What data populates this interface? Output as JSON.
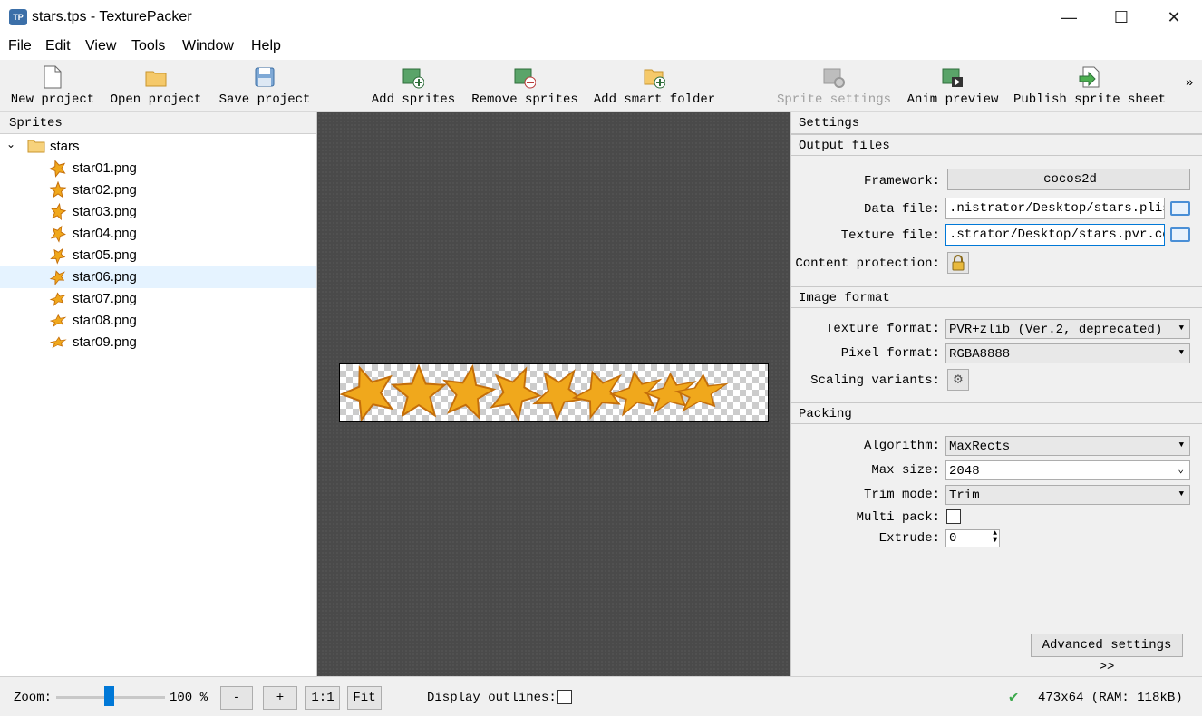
{
  "window": {
    "title": "stars.tps - TexturePacker",
    "app_icon_text": "TP",
    "minimize": "—",
    "maximize": "☐",
    "close": "✕"
  },
  "menu": [
    "File",
    "Edit",
    "View",
    "Tools",
    "Window",
    "Help"
  ],
  "toolbar": {
    "new_project": "New project",
    "open_project": "Open project",
    "save_project": "Save project",
    "add_sprites": "Add sprites",
    "remove_sprites": "Remove sprites",
    "add_smart_folder": "Add smart folder",
    "sprite_settings": "Sprite settings",
    "anim_preview": "Anim preview",
    "publish_sprite_sheet": "Publish sprite sheet",
    "overflow": "»"
  },
  "sprites": {
    "header": "Sprites",
    "folder": "stars",
    "items": [
      "star01.png",
      "star02.png",
      "star03.png",
      "star04.png",
      "star05.png",
      "star06.png",
      "star07.png",
      "star08.png",
      "star09.png"
    ],
    "selected_index": 5
  },
  "settings": {
    "header": "Settings",
    "output_files": {
      "header": "Output files",
      "framework_label": "Framework:",
      "framework_value": "cocos2d",
      "data_file_label": "Data file:",
      "data_file_value": ".nistrator/Desktop/stars.plist",
      "texture_file_label": "Texture file:",
      "texture_file_value": ".strator/Desktop/stars.pvr.ccz",
      "content_protection_label": "Content protection:"
    },
    "image_format": {
      "header": "Image format",
      "texture_format_label": "Texture format:",
      "texture_format_value": "PVR+zlib (Ver.2, deprecated)",
      "pixel_format_label": "Pixel format:",
      "pixel_format_value": "RGBA8888",
      "scaling_variants_label": "Scaling variants:"
    },
    "packing": {
      "header": "Packing",
      "algorithm_label": "Algorithm:",
      "algorithm_value": "MaxRects",
      "max_size_label": "Max size:",
      "max_size_value": "2048",
      "trim_mode_label": "Trim mode:",
      "trim_mode_value": "Trim",
      "multi_pack_label": "Multi pack:",
      "multi_pack_checked": false,
      "extrude_label": "Extrude:",
      "extrude_value": "0"
    },
    "advanced_button": "Advanced settings >>"
  },
  "status": {
    "zoom_label": "Zoom:",
    "zoom_value": "100 %",
    "zoom_minus": "-",
    "zoom_plus": "+",
    "zoom_one": "1:1",
    "zoom_fit": "Fit",
    "display_outlines_label": "Display outlines:",
    "display_outlines_checked": false,
    "sheet_info": "473x64 (RAM: 118kB)"
  },
  "colors": {
    "star_gold": "#f0a81c",
    "star_dark": "#c46e0a",
    "check_green": "#3aa84a",
    "selection": "#e5f3ff"
  }
}
